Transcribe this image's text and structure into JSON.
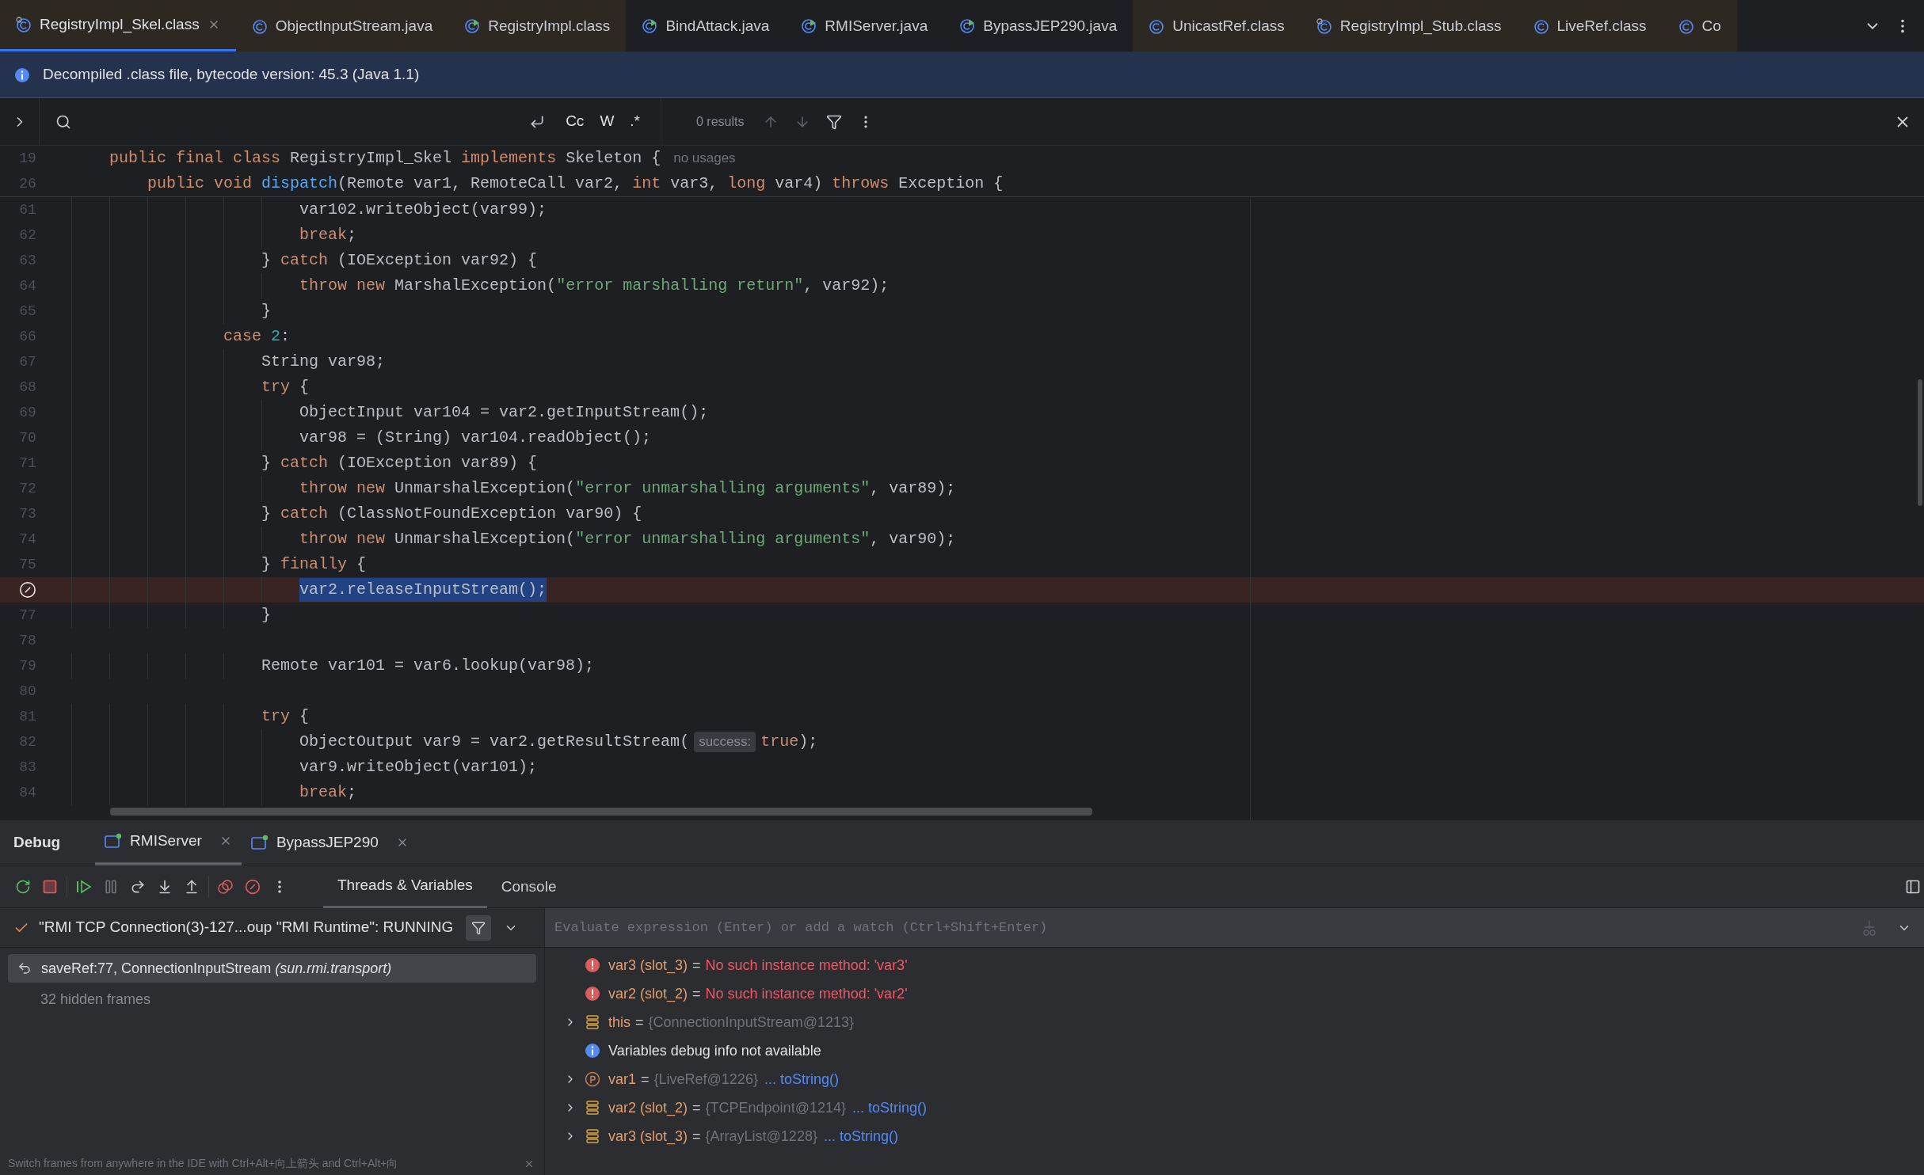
{
  "tabs": [
    {
      "label": "RegistryImpl_Skel.class",
      "kind": "class-linked",
      "selected": true,
      "library": true
    },
    {
      "label": "ObjectInputStream.java",
      "kind": "class",
      "selected": false,
      "library": true
    },
    {
      "label": "RegistryImpl.class",
      "kind": "runnable",
      "selected": false,
      "library": true
    },
    {
      "label": "BindAttack.java",
      "kind": "runnable",
      "selected": false,
      "library": false
    },
    {
      "label": "RMIServer.java",
      "kind": "runnable",
      "selected": false,
      "library": false
    },
    {
      "label": "BypassJEP290.java",
      "kind": "runnable",
      "selected": false,
      "library": false
    },
    {
      "label": "UnicastRef.class",
      "kind": "class",
      "selected": false,
      "library": true
    },
    {
      "label": "RegistryImpl_Stub.class",
      "kind": "class-linked",
      "selected": false,
      "library": true
    },
    {
      "label": "LiveRef.class",
      "kind": "class",
      "selected": false,
      "library": true
    },
    {
      "label": "Co",
      "kind": "class",
      "selected": false,
      "library": true
    }
  ],
  "banner": {
    "text": "Decompiled .class file, bytecode version: 45.3 (Java 1.1)"
  },
  "find_bar": {
    "options": [
      {
        "label": "Cc",
        "selected": false
      },
      {
        "label": "W",
        "selected": false
      },
      {
        "label": ".*",
        "selected": false
      }
    ],
    "results": "0 results"
  },
  "editor": {
    "sticky_lines": [
      {
        "number": "19",
        "tokens": [
          {
            "kind": "keyword",
            "text": "    public final class "
          },
          {
            "kind": "plain",
            "text": "RegistryImpl_Skel "
          },
          {
            "kind": "keyword",
            "text": "implements "
          },
          {
            "kind": "plain",
            "text": "Skeleton {"
          },
          {
            "kind": "usage",
            "text": "no usages"
          }
        ]
      },
      {
        "number": "26",
        "tokens": [
          {
            "kind": "keyword",
            "text": "        public void "
          },
          {
            "kind": "function",
            "text": "dispatch"
          },
          {
            "kind": "plain",
            "text": "(Remote var1, RemoteCall var2, "
          },
          {
            "kind": "keyword",
            "text": "int "
          },
          {
            "kind": "plain",
            "text": "var3, "
          },
          {
            "kind": "keyword",
            "text": "long "
          },
          {
            "kind": "plain",
            "text": "var4) "
          },
          {
            "kind": "keyword",
            "text": "throws "
          },
          {
            "kind": "plain",
            "text": "Exception {"
          }
        ]
      }
    ],
    "lines": [
      {
        "number": "61",
        "tokens": [
          {
            "kind": "plain",
            "text": "                        var102.writeObject(var99);"
          }
        ]
      },
      {
        "number": "62",
        "tokens": [
          {
            "kind": "keyword",
            "text": "                        break"
          },
          {
            "kind": "plain",
            "text": ";"
          }
        ]
      },
      {
        "number": "63",
        "tokens": [
          {
            "kind": "plain",
            "text": "                    } "
          },
          {
            "kind": "keyword",
            "text": "catch "
          },
          {
            "kind": "plain",
            "text": "(IOException var92) {"
          }
        ]
      },
      {
        "number": "64",
        "tokens": [
          {
            "kind": "keyword",
            "text": "                        throw new "
          },
          {
            "kind": "plain",
            "text": "MarshalException("
          },
          {
            "kind": "string",
            "text": "\"error marshalling return\""
          },
          {
            "kind": "plain",
            "text": ", var92);"
          }
        ]
      },
      {
        "number": "65",
        "tokens": [
          {
            "kind": "plain",
            "text": "                    }"
          }
        ]
      },
      {
        "number": "66",
        "tokens": [
          {
            "kind": "keyword",
            "text": "                case "
          },
          {
            "kind": "number",
            "text": "2"
          },
          {
            "kind": "plain",
            "text": ":"
          }
        ]
      },
      {
        "number": "67",
        "tokens": [
          {
            "kind": "plain",
            "text": "                    String var98;"
          }
        ]
      },
      {
        "number": "68",
        "tokens": [
          {
            "kind": "keyword",
            "text": "                    try "
          },
          {
            "kind": "plain",
            "text": "{"
          }
        ]
      },
      {
        "number": "69",
        "tokens": [
          {
            "kind": "plain",
            "text": "                        ObjectInput var104 = var2.getInputStream();"
          }
        ]
      },
      {
        "number": "70",
        "tokens": [
          {
            "kind": "plain",
            "text": "                        var98 = (String) var104.readObject();"
          }
        ]
      },
      {
        "number": "71",
        "tokens": [
          {
            "kind": "plain",
            "text": "                    } "
          },
          {
            "kind": "keyword",
            "text": "catch "
          },
          {
            "kind": "plain",
            "text": "(IOException var89) {"
          }
        ]
      },
      {
        "number": "72",
        "tokens": [
          {
            "kind": "keyword",
            "text": "                        throw new "
          },
          {
            "kind": "plain",
            "text": "UnmarshalException("
          },
          {
            "kind": "string",
            "text": "\"error unmarshalling arguments\""
          },
          {
            "kind": "plain",
            "text": ", var89);"
          }
        ]
      },
      {
        "number": "73",
        "tokens": [
          {
            "kind": "plain",
            "text": "                    } "
          },
          {
            "kind": "keyword",
            "text": "catch "
          },
          {
            "kind": "plain",
            "text": "(ClassNotFoundException var90) {"
          }
        ]
      },
      {
        "number": "74",
        "tokens": [
          {
            "kind": "keyword",
            "text": "                        throw new "
          },
          {
            "kind": "plain",
            "text": "UnmarshalException("
          },
          {
            "kind": "string",
            "text": "\"error unmarshalling arguments\""
          },
          {
            "kind": "plain",
            "text": ", var90);"
          }
        ]
      },
      {
        "number": "75",
        "tokens": [
          {
            "kind": "plain",
            "text": "                    } "
          },
          {
            "kind": "keyword",
            "text": "finally "
          },
          {
            "kind": "plain",
            "text": "{"
          }
        ]
      },
      {
        "breakpoint": true,
        "tokens": [
          {
            "kind": "selected",
            "text": "                        var2.releaseInputStream();"
          }
        ]
      },
      {
        "number": "77",
        "tokens": [
          {
            "kind": "plain",
            "text": "                    }"
          }
        ]
      },
      {
        "number": "78"
      },
      {
        "number": "79",
        "tokens": [
          {
            "kind": "plain",
            "text": "                    Remote var101 = var6.lookup(var98);"
          }
        ]
      },
      {
        "number": "80"
      },
      {
        "number": "81",
        "tokens": [
          {
            "kind": "keyword",
            "text": "                    try "
          },
          {
            "kind": "plain",
            "text": "{"
          }
        ]
      },
      {
        "number": "82",
        "tokens": [
          {
            "kind": "plain",
            "text": "                        ObjectOutput var9 = var2.getResultStream("
          },
          {
            "kind": "hint",
            "text": "success:"
          },
          {
            "kind": "keyword",
            "text": "true"
          },
          {
            "kind": "plain",
            "text": ");"
          }
        ]
      },
      {
        "number": "83",
        "tokens": [
          {
            "kind": "plain",
            "text": "                        var9.writeObject(var101);"
          }
        ]
      },
      {
        "number": "84",
        "tokens": [
          {
            "kind": "keyword",
            "text": "                        break"
          },
          {
            "kind": "plain",
            "text": ";"
          }
        ]
      }
    ]
  },
  "debug": {
    "title": "Debug",
    "sessions": [
      {
        "label": "RMIServer",
        "selected": true
      },
      {
        "label": "BypassJEP290",
        "selected": false
      }
    ],
    "views": [
      {
        "label": "Threads & Variables",
        "selected": true
      },
      {
        "label": "Console",
        "selected": false
      }
    ],
    "thread": "\"RMI TCP Connection(3)-127...oup \"RMI Runtime\": RUNNING",
    "frames": [
      {
        "method": "saveRef:77, ConnectionInputStream",
        "package": "(sun.rmi.transport)",
        "selected": true
      }
    ],
    "hidden_frames": "32 hidden frames",
    "evaluate": {
      "placeholder": "Evaluate expression (Enter) or add a watch (Ctrl+Shift+Enter)"
    },
    "variables": [
      {
        "kind": "error",
        "name": "var3 (slot_3)",
        "eq": "=",
        "value": "No such instance method: 'var3'"
      },
      {
        "kind": "error",
        "name": "var2 (slot_2)",
        "eq": "=",
        "value": "No such instance method: 'var2'"
      },
      {
        "kind": "field",
        "name": "this",
        "eq": "=",
        "value": "{ConnectionInputStream@1213}",
        "expanded": false
      },
      {
        "kind": "info",
        "name": "Variables debug info not available"
      },
      {
        "kind": "param",
        "name": "var1",
        "eq": "=",
        "value": "{LiveRef@1226}",
        "link": "... toString()",
        "expanded": false
      },
      {
        "kind": "field",
        "name": "var2 (slot_2)",
        "eq": "=",
        "value": "{TCPEndpoint@1214}",
        "link": "... toString()",
        "expanded": false
      },
      {
        "kind": "field",
        "name": "var3 (slot_3)",
        "eq": "=",
        "value": "{ArrayList@1228}",
        "link": "... toString()",
        "expanded": false
      }
    ],
    "hint": "Switch frames from anywhere in the IDE with Ctrl+Alt+向上箭头 and Ctrl+Alt+向"
  }
}
